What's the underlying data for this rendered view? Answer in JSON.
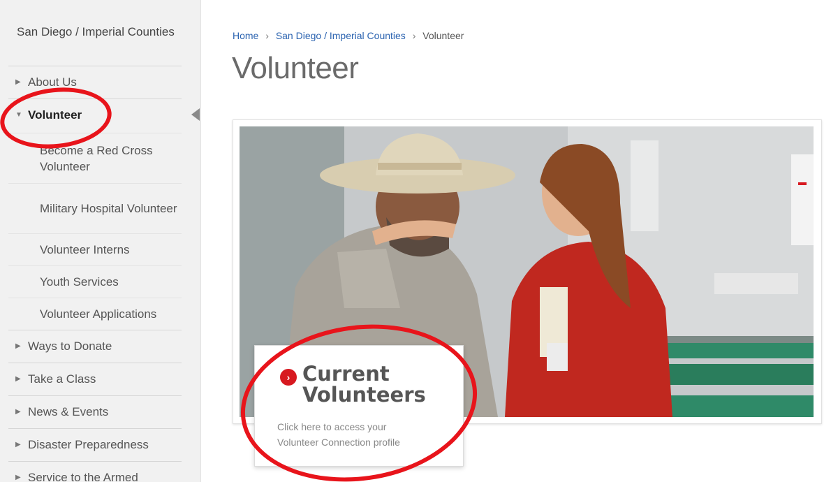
{
  "sidebar": {
    "region": "San Diego / Imperial Counties",
    "about": "About Us",
    "volunteer": "Volunteer",
    "sub": [
      "Become a Red Cross Volunteer",
      "Military Hospital Volunteer",
      "Volunteer Interns",
      "Youth Services",
      "Volunteer Applications"
    ],
    "items": [
      "Ways to Donate",
      "Take a Class",
      "News & Events",
      "Disaster Preparedness",
      "Service to the Armed"
    ]
  },
  "breadcrumb": {
    "home": "Home",
    "region": "San Diego / Imperial Counties",
    "current": "Volunteer",
    "separator": "›"
  },
  "page": {
    "title": "Volunteer"
  },
  "cta": {
    "title_line1": "Current",
    "title_line2": "Volunteers",
    "subtitle_line1": "Click here to access your",
    "subtitle_line2": "Volunteer Connection profile"
  },
  "colors": {
    "accent_red": "#d71920",
    "annotation_red": "#e8141b",
    "link_blue": "#2b63b0"
  },
  "icons": {
    "collapsed": "triangle-right-icon",
    "expanded": "triangle-down-icon",
    "cta": "chevron-right-circle-icon"
  }
}
